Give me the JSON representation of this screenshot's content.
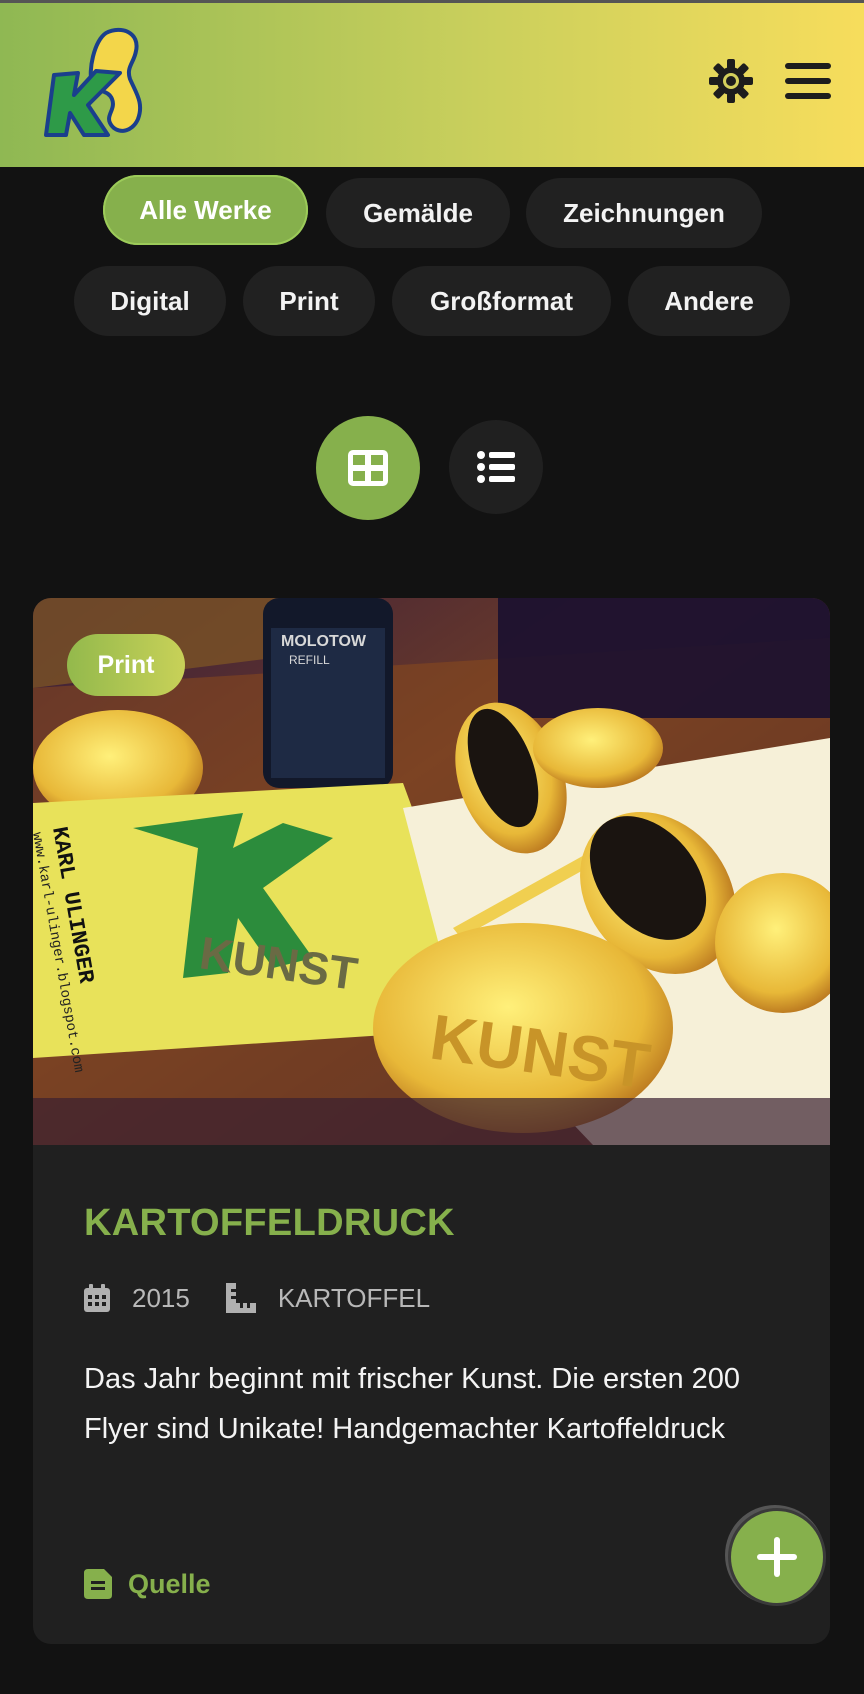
{
  "header": {
    "logo_alt": "K",
    "theme_icon": "sun-gear-icon",
    "menu_icon": "hamburger-icon"
  },
  "filters": [
    {
      "label": "Alle Werke",
      "active": true
    },
    {
      "label": "Gemälde",
      "active": false
    },
    {
      "label": "Zeichnungen",
      "active": false
    },
    {
      "label": "Digital",
      "active": false
    },
    {
      "label": "Print",
      "active": false
    },
    {
      "label": "Großformat",
      "active": false
    },
    {
      "label": "Andere",
      "active": false
    }
  ],
  "view_toggle": {
    "grid_icon": "grid-view-icon",
    "list_icon": "list-view-icon",
    "active": "grid"
  },
  "card": {
    "badge": "Print",
    "title": "KARTOFFELDRUCK",
    "year": "2015",
    "material": "KARTOFFEL",
    "description": "Das Jahr beginnt mit frischer Kunst. Die ersten 200 Flyer sind Unikate! Handgemachter Kartoffeldruck",
    "source_label": "Quelle",
    "image_texts": {
      "name_card": "KARL ULINGER",
      "url": "www.karl-ulinger.blogspot.com",
      "bottle_brand": "MOLOTOW",
      "bottle_sub": "REFILL",
      "kunst": "KUNST"
    }
  },
  "fab": {
    "icon": "plus-icon"
  },
  "colors": {
    "accent": "#86b04c",
    "header_start": "#8fb853",
    "header_end": "#f7dd5c",
    "background": "#121212",
    "card": "#202020"
  }
}
